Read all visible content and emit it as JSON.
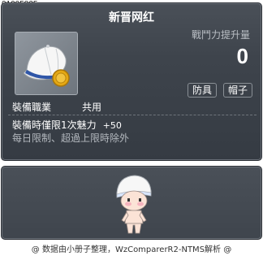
{
  "item_id": "01005825",
  "tooltip": {
    "title": "新晋网红",
    "power_label": "戰鬥力提升量",
    "power_value": "0",
    "tags": [
      "防具",
      "帽子"
    ],
    "job_label": "裝備職業",
    "job_value": "共用",
    "effect_text": "裝備時僅限1次魅力",
    "effect_bonus": "+50",
    "limit_text": "每日限制、超過上限時除外"
  },
  "preview": {
    "avatar_icon": "character-avatar-icon"
  },
  "footer": "@ 数据由小册子整理，WzComparerR2-NTMS解析 @",
  "colors": {
    "panel_top": "#4a5058",
    "panel_bottom": "#353b43",
    "text_primary": "#ffffff",
    "text_muted": "#b3b8be",
    "cap_white": "#f4f4f4",
    "cap_blue": "#2f56a8",
    "coin_gold": "#e5a813"
  }
}
